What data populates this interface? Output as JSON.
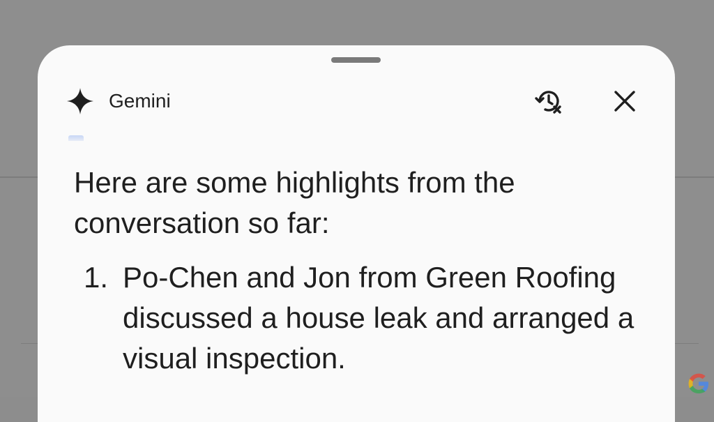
{
  "app": {
    "title": "Gemini",
    "icons": {
      "brand": "gemini-spark-icon",
      "clear_history": "history-clear-icon",
      "close": "close-icon",
      "watermark": "google-g-logo"
    }
  },
  "message": {
    "intro": "Here are some highlights from the conversation so far:",
    "highlights": [
      {
        "number": "1.",
        "text": "Po-Chen and Jon from Green Roofing discussed a house leak and arranged a visual inspection."
      }
    ]
  },
  "colors": {
    "backdrop": "#8e8e8e",
    "sheet": "#fafafa",
    "text": "#1f1f1f"
  }
}
